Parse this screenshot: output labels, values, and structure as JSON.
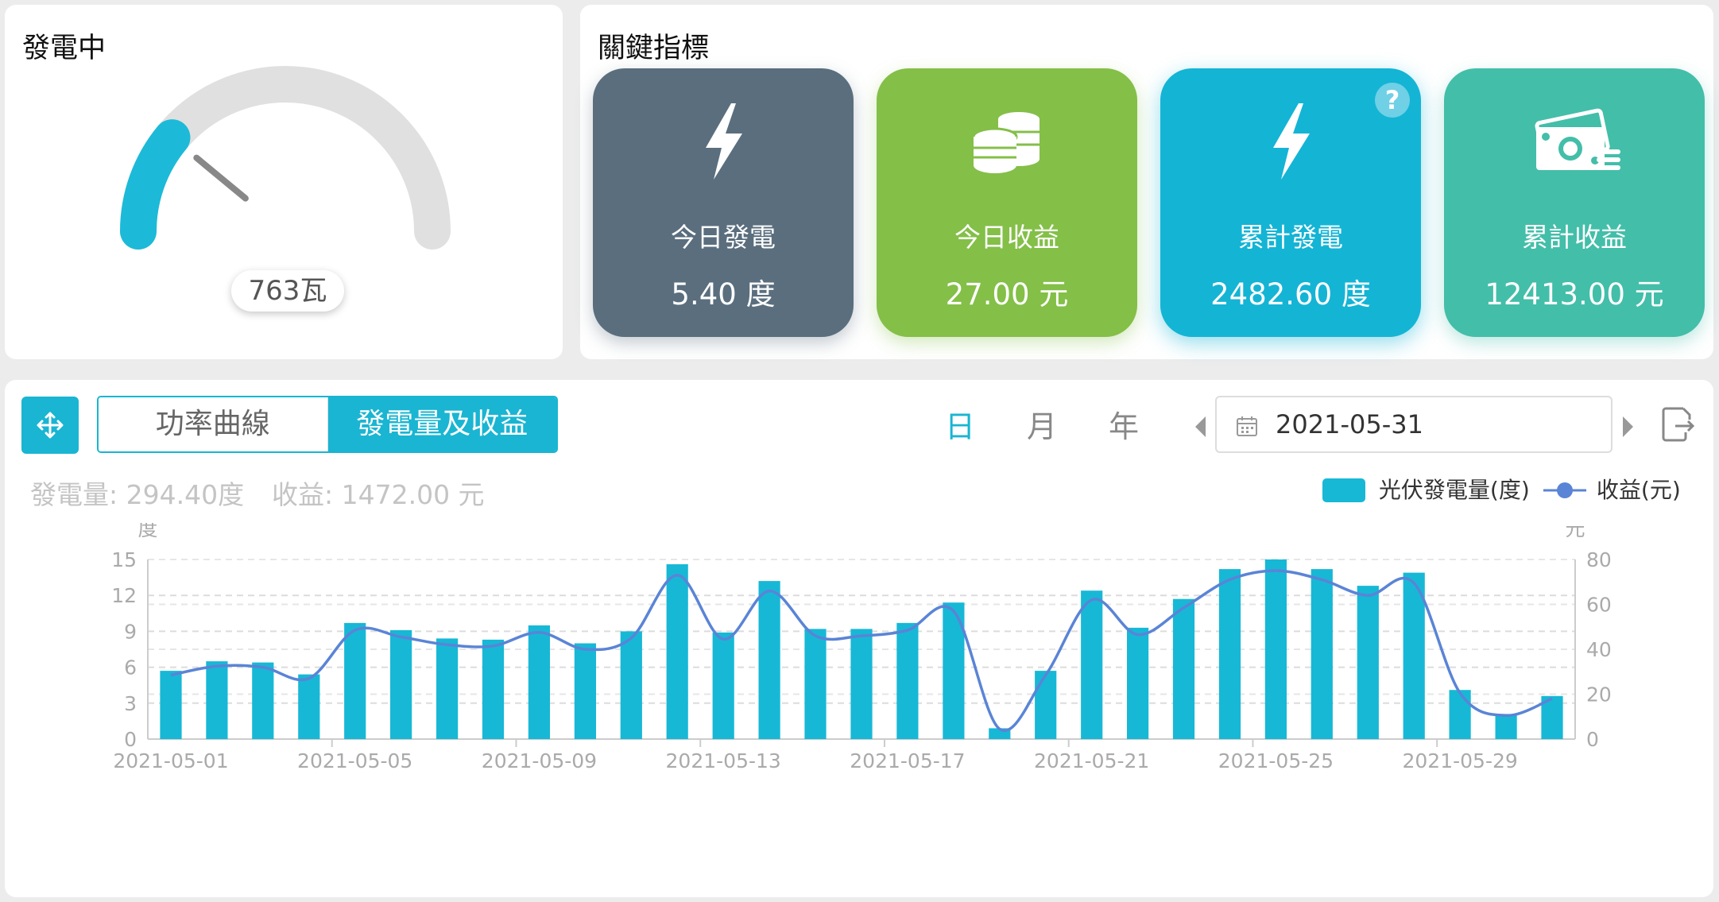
{
  "gauge": {
    "title": "發電中",
    "value_text": "763瓦",
    "fraction": 0.22
  },
  "kpi": {
    "title": "關鍵指標",
    "cards": [
      {
        "label": "今日發電",
        "value": "5.40 度",
        "color": "#5a6e7e",
        "icon": "lightning-icon"
      },
      {
        "label": "今日收益",
        "value": "27.00 元",
        "color": "#84bf48",
        "icon": "coins-icon"
      },
      {
        "label": "累計發電",
        "value": "2482.60 度",
        "color": "#14b4d5",
        "icon": "lightning-icon",
        "help": "?"
      },
      {
        "label": "累計收益",
        "value": "12413.00 元",
        "color": "#43bea9",
        "icon": "cash-icon"
      }
    ]
  },
  "toolbar": {
    "tabs": [
      "功率曲線",
      "發電量及收益"
    ],
    "active_tab": 1,
    "periods": [
      "日",
      "月",
      "年"
    ],
    "active_period": 0,
    "date": "2021-05-31"
  },
  "summary": {
    "generation": "發電量: 294.40度",
    "revenue": "收益: 1472.00 元"
  },
  "legend": {
    "bar": "光伏發電量(度)",
    "line": "收益(元)"
  },
  "colors": {
    "accent": "#19b5d2",
    "bar": "#17b8d6",
    "line": "#5a84d6"
  },
  "chart_data": {
    "type": "bar",
    "y_left_label": "度",
    "y_right_label": "元",
    "ylim_left": [
      0,
      15
    ],
    "ylim_right": [
      0,
      80
    ],
    "yticks_left": [
      0,
      3,
      6,
      9,
      12,
      15
    ],
    "yticks_right": [
      0,
      20,
      40,
      60,
      80
    ],
    "x_tick_labels": [
      "2021-05-01",
      "2021-05-05",
      "2021-05-09",
      "2021-05-13",
      "2021-05-17",
      "2021-05-21",
      "2021-05-25",
      "2021-05-29"
    ],
    "x": [
      "2021-05-01",
      "2021-05-02",
      "2021-05-03",
      "2021-05-04",
      "2021-05-05",
      "2021-05-06",
      "2021-05-07",
      "2021-05-08",
      "2021-05-09",
      "2021-05-10",
      "2021-05-11",
      "2021-05-12",
      "2021-05-13",
      "2021-05-14",
      "2021-05-15",
      "2021-05-16",
      "2021-05-17",
      "2021-05-18",
      "2021-05-19",
      "2021-05-20",
      "2021-05-21",
      "2021-05-22",
      "2021-05-23",
      "2021-05-24",
      "2021-05-25",
      "2021-05-26",
      "2021-05-27",
      "2021-05-28",
      "2021-05-29",
      "2021-05-30",
      "2021-05-31"
    ],
    "series": [
      {
        "name": "光伏發電量(度)",
        "type": "bar",
        "axis": "left",
        "values": [
          5.7,
          6.5,
          6.4,
          5.4,
          9.7,
          9.1,
          8.4,
          8.3,
          9.5,
          8.0,
          9.0,
          14.6,
          8.9,
          13.2,
          9.2,
          9.2,
          9.7,
          11.4,
          0.9,
          5.7,
          12.4,
          9.3,
          11.7,
          14.2,
          15.0,
          14.2,
          12.8,
          13.9,
          4.1,
          2.1,
          3.6
        ]
      },
      {
        "name": "收益(元)",
        "type": "line",
        "axis": "right",
        "values": [
          28.5,
          32.5,
          32.0,
          27.0,
          48.5,
          45.5,
          42.0,
          41.5,
          47.5,
          40.0,
          45.0,
          73.0,
          44.5,
          66.0,
          46.0,
          46.0,
          48.5,
          57.0,
          4.5,
          28.5,
          62.0,
          46.5,
          58.5,
          71.0,
          75.0,
          71.0,
          64.0,
          69.5,
          20.5,
          10.5,
          18.0
        ]
      }
    ]
  }
}
